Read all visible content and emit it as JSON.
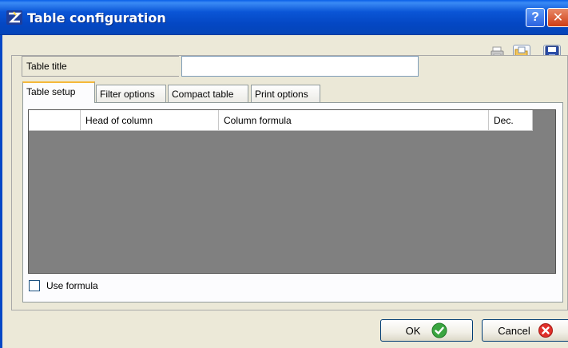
{
  "window": {
    "title": "Table configuration",
    "help_glyph": "?",
    "close_glyph": "✕"
  },
  "toolbar": {
    "icons": [
      "print-icon",
      "open-folder-icon",
      "save-disk-icon"
    ]
  },
  "form": {
    "title_label": "Table title",
    "title_value": ""
  },
  "tabs": [
    {
      "label": "Table setup",
      "active": true
    },
    {
      "label": "Filter options",
      "active": false
    },
    {
      "label": "Compact table",
      "active": false
    },
    {
      "label": "Print options",
      "active": false
    }
  ],
  "grid": {
    "columns": [
      "",
      "Head of column",
      "Column formula",
      "Dec."
    ],
    "rows": []
  },
  "use_formula": {
    "label": "Use formula",
    "checked": false
  },
  "buttons": {
    "ok_label": "OK",
    "cancel_label": "Cancel"
  },
  "colors": {
    "titlebar": "#0a55d6",
    "grid_background": "#808080",
    "ok_icon": "#3aa540",
    "cancel_icon": "#e0302a"
  }
}
